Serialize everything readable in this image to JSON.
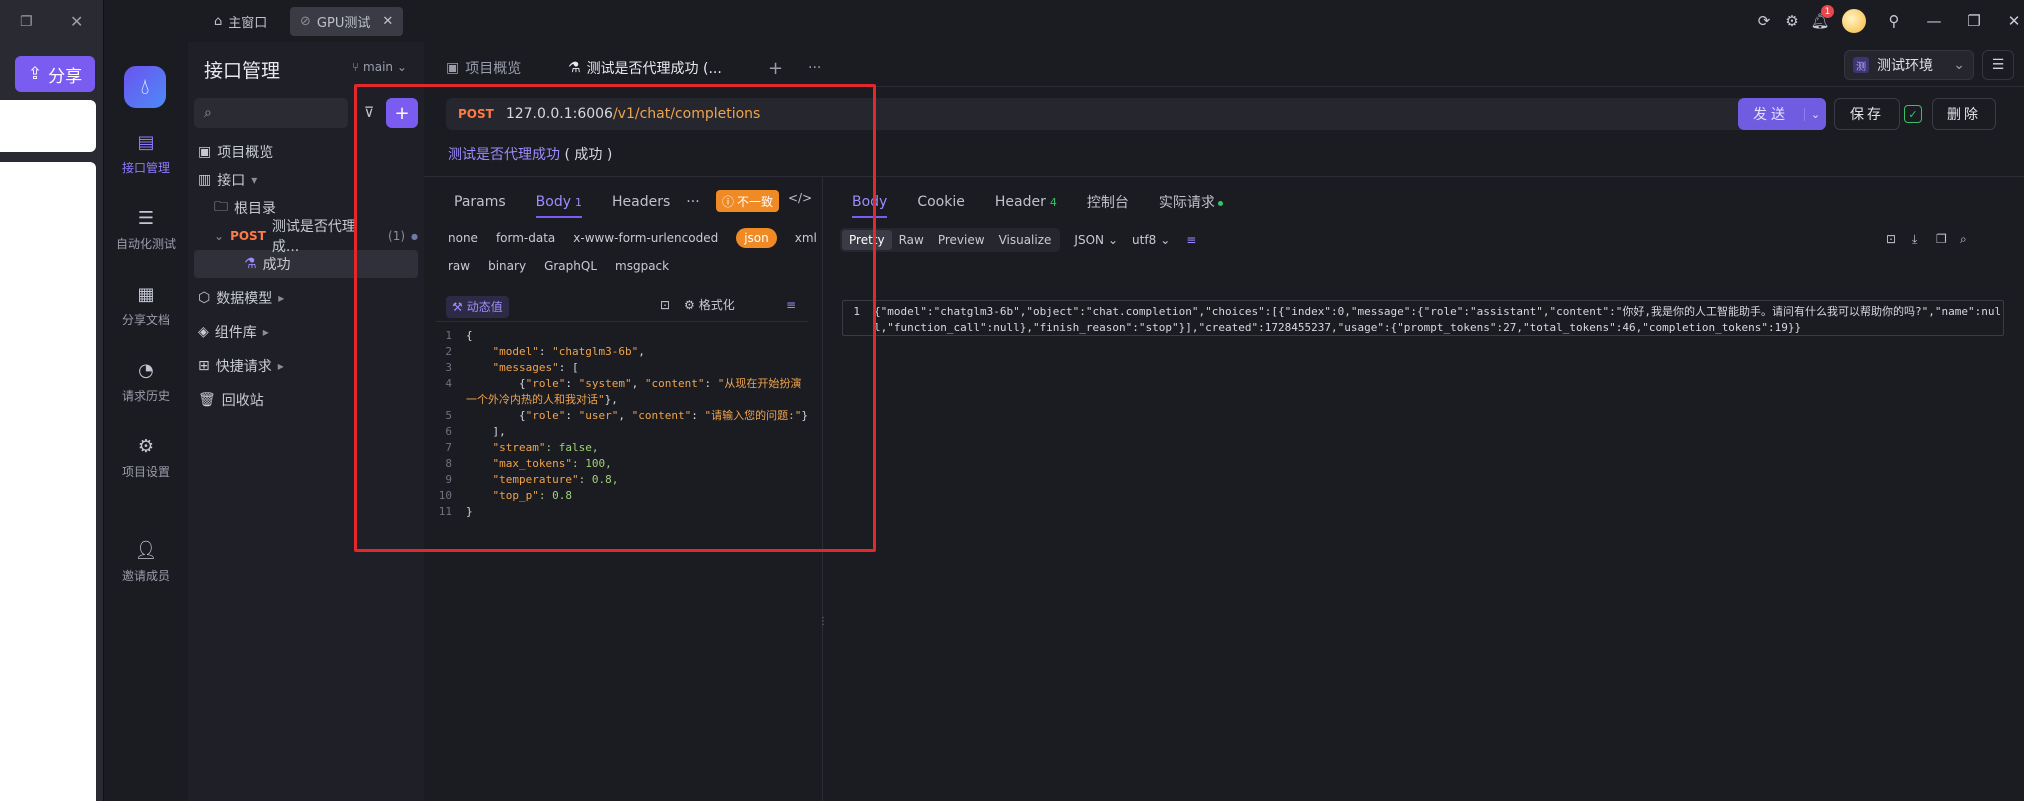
{
  "left_pane": {
    "share_label": "分享"
  },
  "titlebar": {
    "tabs": [
      {
        "label": "主窗口"
      },
      {
        "label": "GPU测试"
      }
    ],
    "notification_count": "1"
  },
  "rail": {
    "items": [
      {
        "label": "接口管理"
      },
      {
        "label": "自动化测试"
      },
      {
        "label": "分享文档"
      },
      {
        "label": "请求历史"
      },
      {
        "label": "项目设置"
      },
      {
        "label": "邀请成员"
      }
    ]
  },
  "tree": {
    "title": "接口管理",
    "branch": "main",
    "search_placeholder": "",
    "items": [
      {
        "label": "项目概览"
      },
      {
        "label": "接口"
      },
      {
        "label": "根目录"
      },
      {
        "method": "POST",
        "label": "测试是否代理成...",
        "count": "(1)"
      },
      {
        "label": "成功"
      },
      {
        "label": "数据模型"
      },
      {
        "label": "组件库"
      },
      {
        "label": "快捷请求"
      },
      {
        "label": "回收站"
      }
    ]
  },
  "main": {
    "tabs": [
      {
        "label": "项目概览"
      },
      {
        "label": "测试是否代理成功 (..."
      }
    ],
    "environment": {
      "badge": "测",
      "label": "测试环境"
    },
    "url": {
      "method": "POST",
      "host": "127.0.0.1:6006",
      "path": "/v1/chat/completions"
    },
    "send_label": "发送",
    "save_label": "保存",
    "delete_label": "删除",
    "request_name": "测试是否代理成功",
    "request_status": "( 成功 )",
    "request_tabs": [
      {
        "label": "Params"
      },
      {
        "label": "Body",
        "count": "1"
      },
      {
        "label": "Headers"
      },
      {
        "label": "···"
      }
    ],
    "mismatch_label": "不一致",
    "body_types": [
      "none",
      "form-data",
      "x-www-form-urlencoded",
      "json",
      "xml",
      "raw",
      "binary",
      "GraphQL",
      "msgpack"
    ],
    "dynamic_label": "动态值",
    "format_label": "格式化",
    "response_tabs": [
      {
        "label": "Body"
      },
      {
        "label": "Cookie"
      },
      {
        "label": "Header",
        "count": "4"
      },
      {
        "label": "控制台"
      },
      {
        "label": "实际请求"
      }
    ],
    "response_views": [
      "Pretty",
      "Raw",
      "Preview",
      "Visualize"
    ],
    "response_format": "JSON",
    "response_encoding": "utf8",
    "response_line_number": "1"
  },
  "code_lines": [
    {
      "n": "1",
      "t": "{"
    },
    {
      "n": "2",
      "t": "    \"model\": \"chatglm3-6b\","
    },
    {
      "n": "3",
      "t": "    \"messages\": ["
    },
    {
      "n": "4",
      "t": "        {\"role\": \"system\", \"content\": \"从现在开始扮演一个外冷内热的人和我对话\"},"
    },
    {
      "n": "5",
      "t": "        {\"role\": \"user\", \"content\": \"请输入您的问题:\"}"
    },
    {
      "n": "6",
      "t": "    ],"
    },
    {
      "n": "7",
      "t": "    \"stream\": false,"
    },
    {
      "n": "8",
      "t": "    \"max_tokens\": 100,"
    },
    {
      "n": "9",
      "t": "    \"temperature\": 0.8,"
    },
    {
      "n": "10",
      "t": "    \"top_p\": 0.8"
    },
    {
      "n": "11",
      "t": "}"
    }
  ],
  "response_text": "{\"model\":\"chatglm3-6b\",\"object\":\"chat.completion\",\"choices\":[{\"index\":0,\"message\":{\"role\":\"assistant\",\"content\":\"你好,我是你的人工智能助手。请问有什么我可以帮助你的吗?\",\"name\":null,\"function_call\":null},\"finish_reason\":\"stop\"}],\"created\":1728455237,\"usage\":{\"prompt_tokens\":27,\"total_tokens\":46,\"completion_tokens\":19}}"
}
